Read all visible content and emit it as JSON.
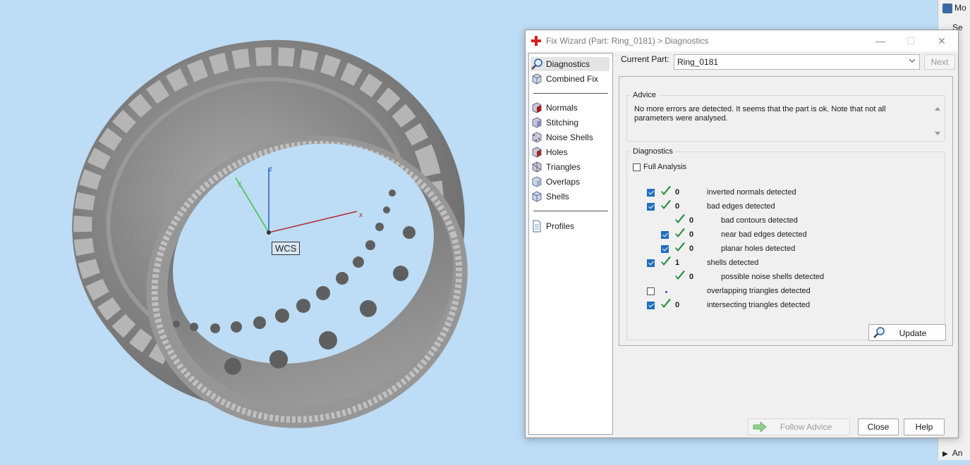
{
  "viewport": {
    "wcs_label": "WCS",
    "axis_x": "x",
    "axis_y": "y",
    "axis_z": "z"
  },
  "side_panel": {
    "row1": "Mo",
    "row2": "Se",
    "row3": "An"
  },
  "dialog": {
    "title": "Fix Wizard (Part: Ring_0181) > Diagnostics",
    "nav_items": [
      {
        "label": "Diagnostics",
        "icon": "magnifier-icon"
      },
      {
        "label": "Combined Fix",
        "icon": "cube-icon"
      },
      {
        "label": "Normals",
        "icon": "cube-red-face-icon"
      },
      {
        "label": "Stitching",
        "icon": "stitch-cube-icon"
      },
      {
        "label": "Noise Shells",
        "icon": "noise-cube-icon"
      },
      {
        "label": "Holes",
        "icon": "hole-cube-icon"
      },
      {
        "label": "Triangles",
        "icon": "triangles-icon"
      },
      {
        "label": "Overlaps",
        "icon": "overlaps-cube-icon"
      },
      {
        "label": "Shells",
        "icon": "shells-cube-icon"
      },
      {
        "label": "Profiles",
        "icon": "document-icon"
      }
    ],
    "current_part_label": "Current Part:",
    "current_part_value": "Ring_0181",
    "next_label": "Next",
    "advice": {
      "legend": "Advice",
      "text": "No more errors are detected. It seems that the part is ok. Note that not all parameters were analysed."
    },
    "diagnostics": {
      "legend": "Diagnostics",
      "full_analysis_label": "Full Analysis",
      "full_analysis_checked": false,
      "rows": [
        {
          "checked": true,
          "has_checkbox": true,
          "ok": true,
          "count": "0",
          "label": "inverted normals detected",
          "indent": 0
        },
        {
          "checked": true,
          "has_checkbox": true,
          "ok": true,
          "count": "0",
          "label": "bad edges detected",
          "indent": 0
        },
        {
          "checked": false,
          "has_checkbox": false,
          "ok": true,
          "count": "0",
          "label": "bad contours detected",
          "indent": 1
        },
        {
          "checked": true,
          "has_checkbox": true,
          "ok": true,
          "count": "0",
          "label": "near bad edges detected",
          "indent": 1
        },
        {
          "checked": true,
          "has_checkbox": true,
          "ok": true,
          "count": "0",
          "label": "planar holes detected",
          "indent": 1
        },
        {
          "checked": true,
          "has_checkbox": true,
          "ok": true,
          "count": "1",
          "label": "shells detected",
          "indent": 0
        },
        {
          "checked": false,
          "has_checkbox": false,
          "ok": true,
          "count": "0",
          "label": "possible noise shells detected",
          "indent": 1
        },
        {
          "checked": false,
          "has_checkbox": true,
          "ok": false,
          "count": "",
          "label": "overlapping triangles detected",
          "indent": 0
        },
        {
          "checked": true,
          "has_checkbox": true,
          "ok": true,
          "count": "0",
          "label": "intersecting triangles detected",
          "indent": 0
        }
      ],
      "update_label": "Update"
    },
    "follow_advice_label": "Follow Advice",
    "close_label": "Close",
    "help_label": "Help"
  },
  "colors": {
    "viewport_bg": "#bddcf5",
    "ring": "#8c8c8c",
    "check_green": "#1e8a3a",
    "checkbox_blue": "#1f6fbf"
  }
}
